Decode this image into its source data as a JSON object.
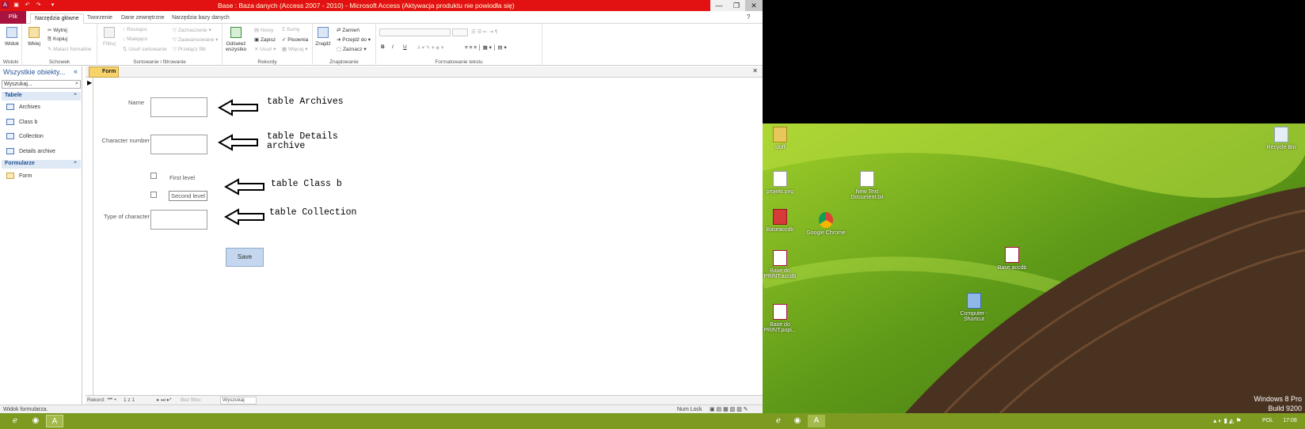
{
  "window": {
    "title": "Base : Baza danych (Access 2007 - 2010) - Microsoft Access (Aktywacja produktu nie powiodła się)",
    "min": "—",
    "max": "❐",
    "close": "✕"
  },
  "ribbon_tabs": [
    "Plik",
    "Narzędzia główne",
    "Tworzenie",
    "Dane zewnętrzne",
    "Narzędzia bazy danych"
  ],
  "ribbon": {
    "widoki": {
      "label": "Widoki",
      "widok": "Widok"
    },
    "schowek": {
      "label": "Schowek",
      "wklej": "Wklej",
      "wytnij": "Wytnij",
      "kopiuj": "Kopiuj",
      "malarz": "Malarz formatów"
    },
    "sort": {
      "label": "Sortowanie i filtrowanie",
      "filtruj": "Filtruj",
      "rosnaco": "Rosnąco",
      "malejaco": "Malejąco",
      "usun_sort": "Usuń sortowanie",
      "zaznaczenie": "Zaznaczenie",
      "zaawansowane": "Zaawansowane",
      "przelacz": "Przełącz filtr"
    },
    "rekordy": {
      "label": "Rekordy",
      "odswiez": "Odśwież wszystko",
      "nowy": "Nowy",
      "zapisz": "Zapisz",
      "usun": "Usuń",
      "sumy": "Sumy",
      "pisownia": "Pisownia",
      "wiecej": "Więcej"
    },
    "znajdowanie": {
      "label": "Znajdowanie",
      "znajdz": "Znajdź",
      "zamien": "Zamień",
      "przejdz": "Przejdź do",
      "zaznacz": "Zaznacz"
    },
    "format": {
      "label": "Formatowanie tekstu"
    }
  },
  "nav": {
    "header": "Wszystkie obiekty...",
    "search_placeholder": "Wyszukaj...",
    "sections": [
      {
        "title": "Tabele",
        "items": [
          "Archives",
          "Class b",
          "Collection",
          "Details archive"
        ]
      },
      {
        "title": "Formularze",
        "items": [
          "Form"
        ]
      }
    ]
  },
  "doc_tab": "Form",
  "form": {
    "name_label": "Name",
    "charnum_label": "Character number",
    "first_level": "First level",
    "second_level": "Second level",
    "type_label": "Type of character",
    "save": "Save"
  },
  "notes": {
    "archives": "table Archives",
    "details": "table Details\narchive",
    "classb": "table Class b",
    "collection": "table Collection"
  },
  "record_nav": {
    "label": "Rekord:",
    "position": "1 z 1",
    "filter": "Bez filtru",
    "search": "Wyszukaj"
  },
  "status": {
    "left": "Widok formularza.",
    "numlock": "Num Lock"
  },
  "desktop": {
    "icons": [
      "stuff",
      "projekt.png",
      "Baseaccdb",
      "Base do PRINT.accdb",
      "Base do PRINT.popi...",
      "New Text Document.txt",
      "Google Chrome",
      "Base.accdb",
      "Computer - Shortcut",
      "Recycle Bin"
    ],
    "watermark_line1": "Windows 8 Pro",
    "watermark_line2": "Build 9200"
  },
  "tray": {
    "lang": "POL",
    "time": "17:08"
  }
}
